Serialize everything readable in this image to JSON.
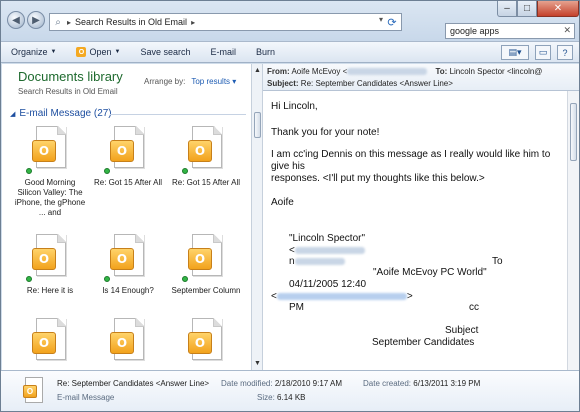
{
  "window": {
    "breadcrumb": [
      "Search Results in Old Email"
    ],
    "search_value": "google apps",
    "controls": {
      "min": "–",
      "max": "□",
      "close": "✕"
    }
  },
  "toolbar": {
    "organize": "Organize",
    "open": "Open",
    "save_search": "Save search",
    "email": "E-mail",
    "burn": "Burn"
  },
  "library": {
    "title": "Documents library",
    "subtitle": "Search Results in Old Email",
    "arrange_label": "Arrange by:",
    "arrange_value": "Top results",
    "group_header": "E-mail Message (27)"
  },
  "files": [
    {
      "label": "Good Morning Silicon Valley: The iPhone, the gPhone ... and"
    },
    {
      "label": "Re: Got 15 After All"
    },
    {
      "label": "Re: Got 15 After All"
    },
    {
      "label": "Re: Here it is"
    },
    {
      "label": "Is 14 Enough?"
    },
    {
      "label": "September Column"
    },
    {
      "label": ""
    },
    {
      "label": ""
    },
    {
      "label": ""
    }
  ],
  "preview": {
    "from_label": "From:",
    "from_name": "Aoife McEvoy <",
    "to_label": "To:",
    "to_name": "Lincoln Spector <lincoln@",
    "subject_label": "Subject:",
    "subject": "Re: September Candidates <Answer Line>",
    "body": [
      "Hi Lincoln,",
      "Thank you for your note!",
      "I am cc'ing Dennis on this message as I really would like him to",
      "give his",
      "responses. <I'll put my thoughts like this below.>",
      "Aoife",
      "\"Lincoln Spector\"",
      "<",
      "n",
      "To",
      "\"Aoife McEvoy PC World\"",
      "04/11/2005 12:40",
      "<",
      ">",
      "PM",
      "cc",
      "Subject",
      "September Candidates"
    ]
  },
  "details": {
    "name": "Re: September Candidates <Answer Line>",
    "type": "E-mail Message",
    "modified_label": "Date modified:",
    "modified_value": "2/18/2010 9:17 AM",
    "created_label": "Date created:",
    "created_value": "6/13/2011 3:19 PM",
    "size_label": "Size:",
    "size_value": "6.14 KB"
  }
}
